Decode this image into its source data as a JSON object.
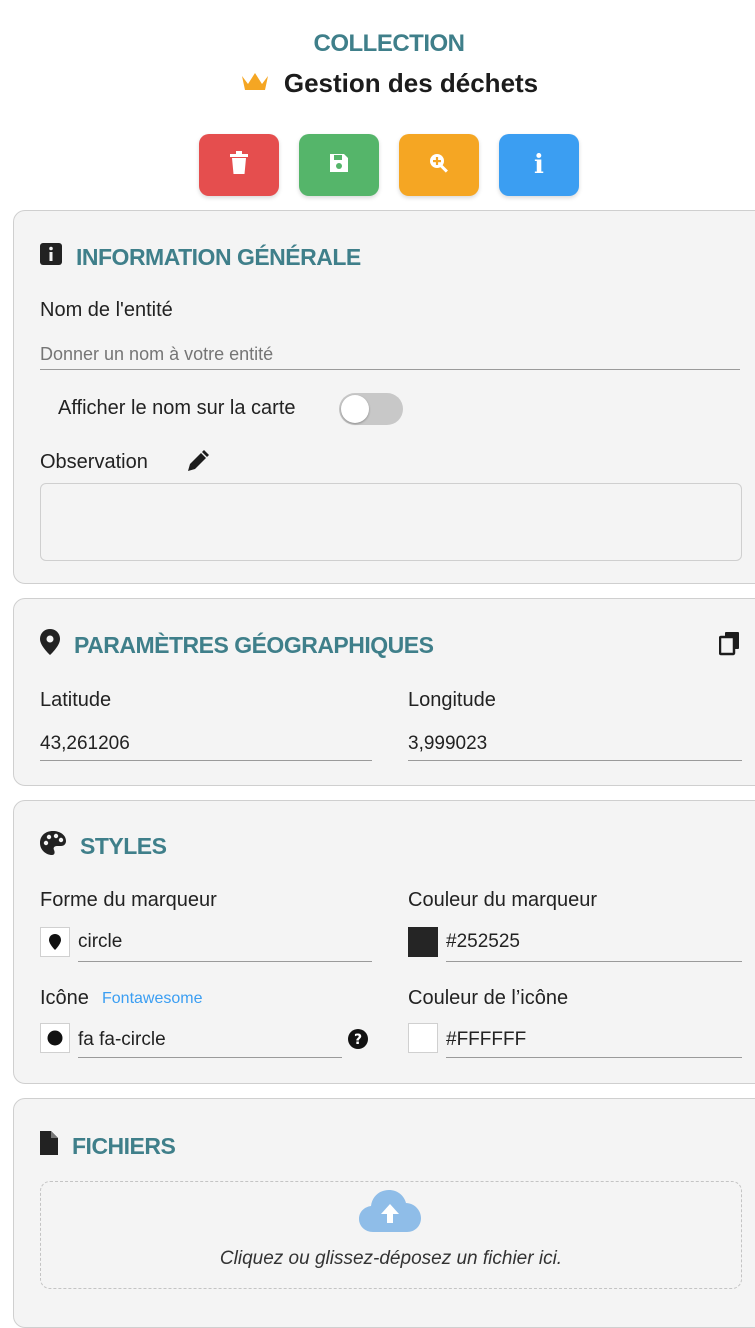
{
  "header": {
    "section": "COLLECTION",
    "title": "Gestion des déchets"
  },
  "toolbar": {
    "buttons": [
      {
        "name": "delete",
        "icon": "trash-icon",
        "color": "#e54e4e"
      },
      {
        "name": "save",
        "icon": "save-icon",
        "color": "#55b56a"
      },
      {
        "name": "zoom",
        "icon": "zoom-in-icon",
        "color": "#f5a623"
      },
      {
        "name": "info",
        "icon": "info-icon",
        "color": "#3b9ef2"
      }
    ]
  },
  "general": {
    "title": "INFORMATION GÉNÉRALE",
    "name_label": "Nom de l'entité",
    "name_placeholder": "Donner un nom à votre entité",
    "name_value": "",
    "toggle_label": "Afficher le nom sur la carte",
    "toggle_on": false,
    "observation_label": "Observation",
    "observation_value": ""
  },
  "geo": {
    "title": "PARAMÈTRES GÉOGRAPHIQUES",
    "latitude_label": "Latitude",
    "latitude_value": "43,261206",
    "longitude_label": "Longitude",
    "longitude_value": "3,999023"
  },
  "styles": {
    "title": "STYLES",
    "marker_shape_label": "Forme du marqueur",
    "marker_shape_value": "circle",
    "marker_color_label": "Couleur du marqueur",
    "marker_color_value": "#252525",
    "icon_label": "Icône",
    "icon_link": "Fontawesome",
    "icon_value": "fa fa-circle",
    "icon_color_label": "Couleur de l’icône",
    "icon_color_value": "#FFFFFF"
  },
  "files": {
    "title": "FICHIERS",
    "dropzone_text": "Cliquez ou glissez-déposez un fichier ici."
  }
}
